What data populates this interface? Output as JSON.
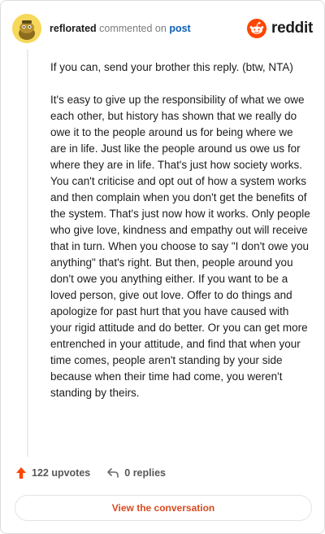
{
  "header": {
    "username": "reflorated",
    "action_text": "commented on",
    "post_link": "post",
    "brand": "reddit"
  },
  "comment": {
    "paragraphs": [
      "If you can, send your brother this reply. (btw, NTA)",
      "It's easy to give up the responsibility of what we owe each other, but history has shown that we really do owe it to the people around us for being where we are in life. Just like the people around us owe us for where they are in life. That's just how society works. You can't criticise and opt out of how a system works and then complain when you don't get the benefits of the system. That's just now how it works. Only people who give love, kindness and empathy out will receive that in turn. When you choose to say \"I don't owe you anything\" that's right. But then, people around you don't owe you anything either. If you want to be a loved person, give out love. Offer to do things and apologize for past hurt that you have caused with your rigid attitude and do better. Or you can get more entrenched in your attitude, and find that when your time comes, people aren't standing by your side because when their time had come, you weren't standing by theirs."
    ]
  },
  "footer": {
    "upvotes": "122 upvotes",
    "replies": "0 replies",
    "cta": "View the conversation"
  },
  "colors": {
    "upvote": "#ff4500",
    "avatar_bg": "#f6d85a",
    "link": "#0b5fb5",
    "cta_text": "#d94a1f"
  },
  "icons": [
    "snoo-avatar-icon",
    "reddit-logo-icon",
    "upvote-arrow-icon",
    "reply-arrow-icon"
  ]
}
